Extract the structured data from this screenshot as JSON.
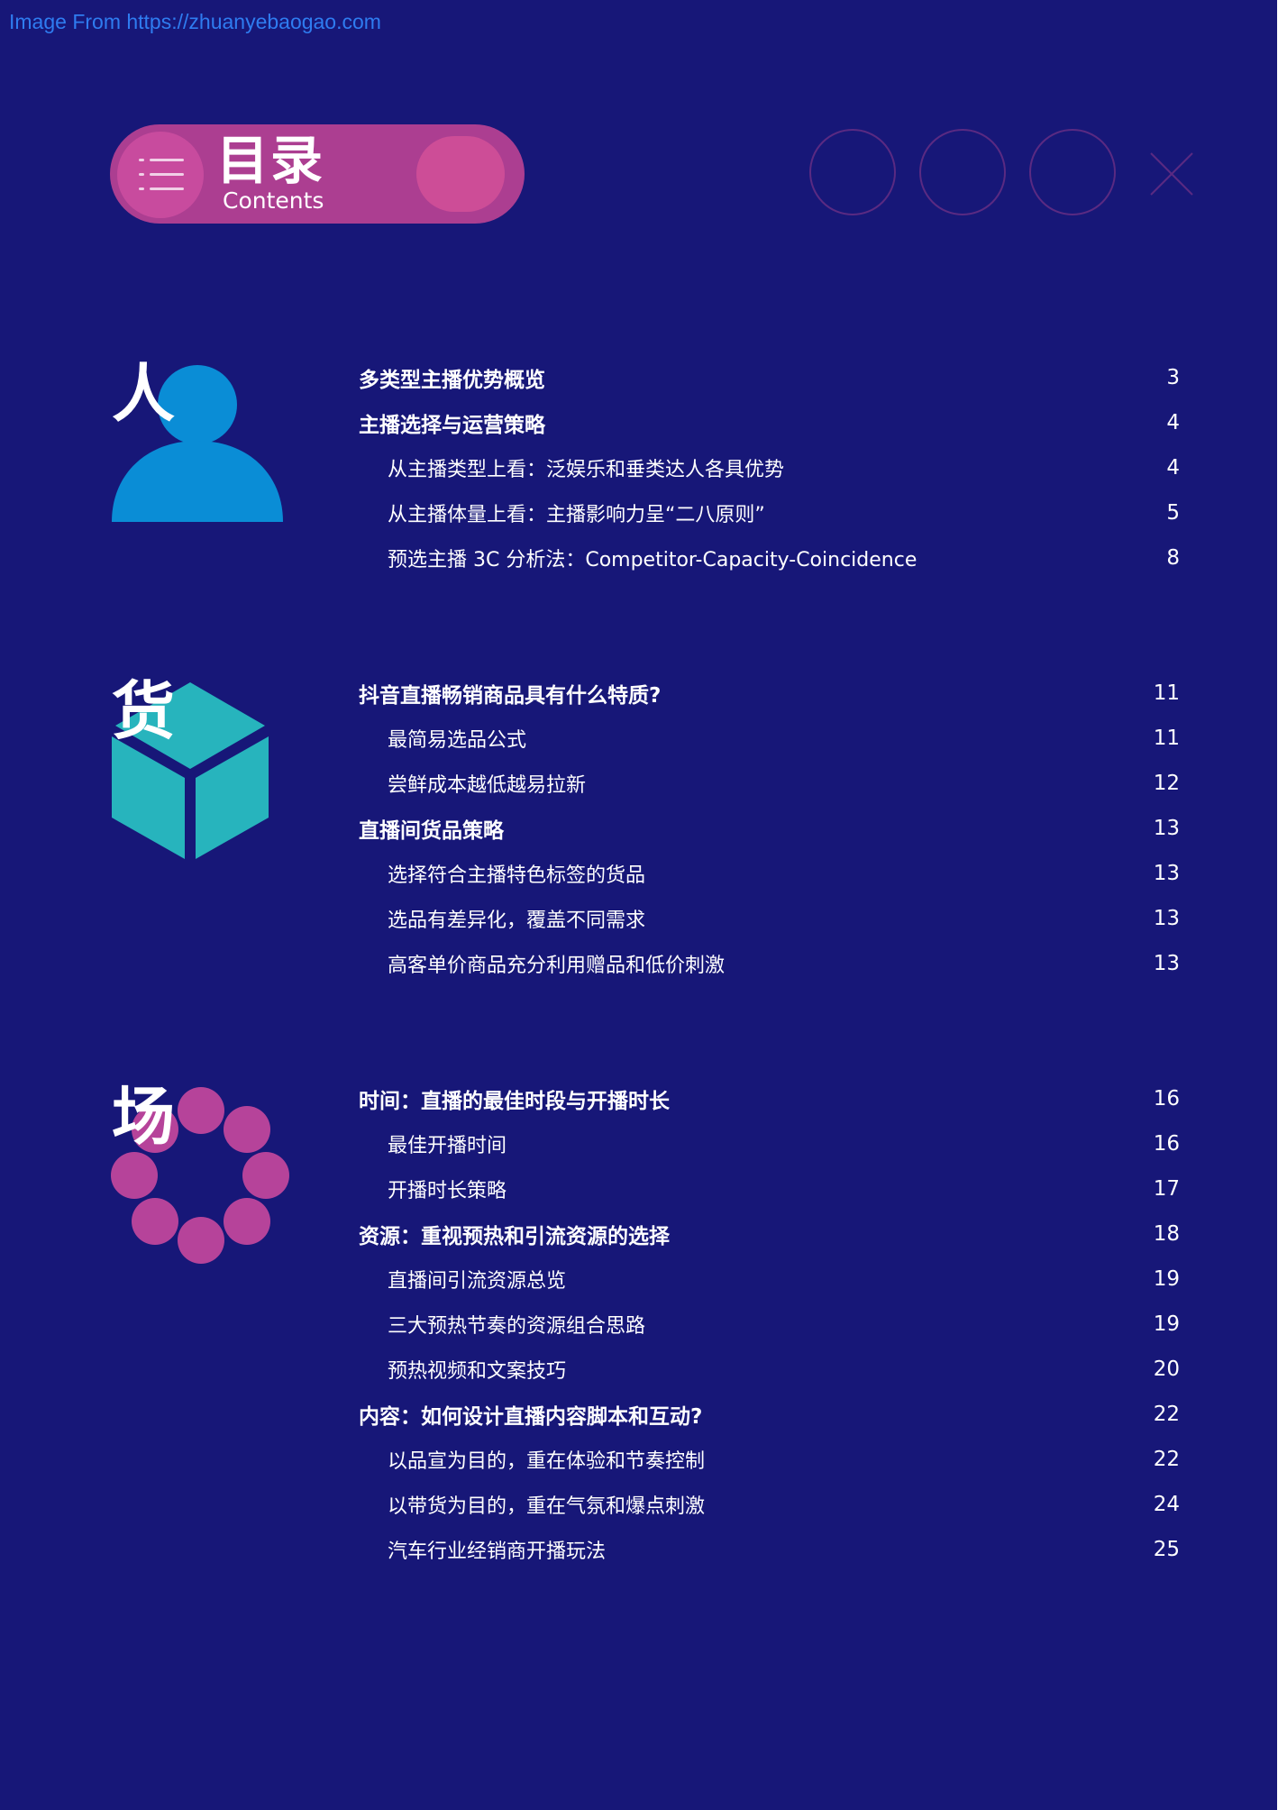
{
  "watermark": "Image From https://zhuanyebaogao.com",
  "header": {
    "title": "目录",
    "subtitle": "Contents"
  },
  "sections": [
    {
      "char": "人",
      "icon": "person-icon",
      "color": "#0a8dd6",
      "entries": [
        {
          "level": "main",
          "title": "多类型主播优势概览",
          "page": "3"
        },
        {
          "level": "main",
          "title": "主播选择与运营策略",
          "page": "4"
        },
        {
          "level": "sub",
          "title": "从主播类型上看：泛娱乐和垂类达人各具优势",
          "page": "4"
        },
        {
          "level": "sub",
          "title": "从主播体量上看：主播影响力呈“二八原则”",
          "page": "5"
        },
        {
          "level": "sub",
          "title": "预选主播 3C 分析法：Competitor-Capacity-Coincidence",
          "page": "8"
        }
      ]
    },
    {
      "char": "货",
      "icon": "cube-icon",
      "color": "#27b4bd",
      "entries": [
        {
          "level": "main",
          "title": "抖音直播畅销商品具有什么特质?",
          "page": "11"
        },
        {
          "level": "sub",
          "title": "最简易选品公式",
          "page": "11"
        },
        {
          "level": "sub",
          "title": "尝鲜成本越低越易拉新",
          "page": "12"
        },
        {
          "level": "main",
          "title": "直播间货品策略",
          "page": "13"
        },
        {
          "level": "sub",
          "title": "选择符合主播特色标签的货品",
          "page": "13"
        },
        {
          "level": "sub",
          "title": "选品有差异化，覆盖不同需求",
          "page": "13"
        },
        {
          "level": "sub",
          "title": "高客单价商品充分利用赠品和低价刺激",
          "page": "13"
        }
      ]
    },
    {
      "char": "场",
      "icon": "dots-ring-icon",
      "color": "#b6439a",
      "entries": [
        {
          "level": "main",
          "title": "时间：直播的最佳时段与开播时长",
          "page": "16"
        },
        {
          "level": "sub",
          "title": "最佳开播时间",
          "page": "16"
        },
        {
          "level": "sub",
          "title": "开播时长策略",
          "page": "17"
        },
        {
          "level": "main",
          "title": "资源：重视预热和引流资源的选择",
          "page": "18"
        },
        {
          "level": "sub",
          "title": "直播间引流资源总览",
          "page": "19"
        },
        {
          "level": "sub",
          "title": "三大预热节奏的资源组合思路",
          "page": "19"
        },
        {
          "level": "sub",
          "title": "预热视频和文案技巧",
          "page": "20"
        },
        {
          "level": "main",
          "title": "内容：如何设计直播内容脚本和互动?",
          "page": "22"
        },
        {
          "level": "sub",
          "title": "以品宣为目的，重在体验和节奏控制",
          "page": "22"
        },
        {
          "level": "sub",
          "title": "以带货为目的，重在气氛和爆点刺激",
          "page": "24"
        },
        {
          "level": "sub",
          "title": "汽车行业经销商开播玩法",
          "page": "25"
        }
      ]
    }
  ]
}
